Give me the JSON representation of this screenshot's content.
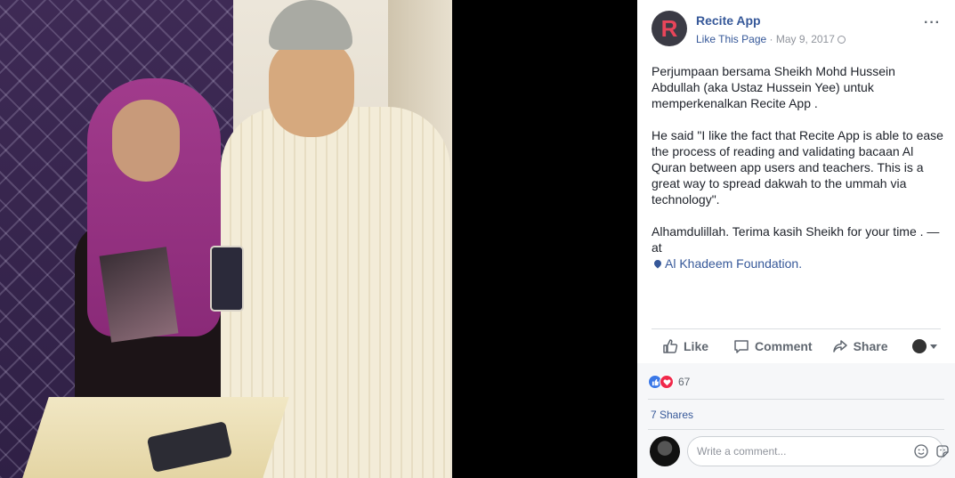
{
  "page": {
    "name": "Recite App",
    "avatar_letter": "R",
    "like_link": "Like This Page",
    "separator": " · ",
    "date": "May 9, 2017",
    "more": "···"
  },
  "post": {
    "para1": "Perjumpaan bersama Sheikh Mohd Hussein Abdullah (aka Ustaz Hussein Yee) untuk memperkenalkan Recite App .",
    "para2": "He said \"I like the fact that Recite App is able to ease the process of reading and validating bacaan Al Quran between app users and teachers. This is a great way to spread dakwah to the ummah via technology\".",
    "para3": "Alhamdulillah. Terima kasih Sheikh for your time . — at",
    "location": "Al Khadeem Foundation."
  },
  "actions": {
    "like": "Like",
    "comment": "Comment",
    "share": "Share"
  },
  "stats": {
    "reaction_count": "67",
    "shares": "7 Shares"
  },
  "comment_box": {
    "placeholder": "Write a comment..."
  },
  "colors": {
    "link": "#365899",
    "brand_red": "#e8455a",
    "like_blue": "#3b78e7",
    "love_red": "#f0284a"
  }
}
